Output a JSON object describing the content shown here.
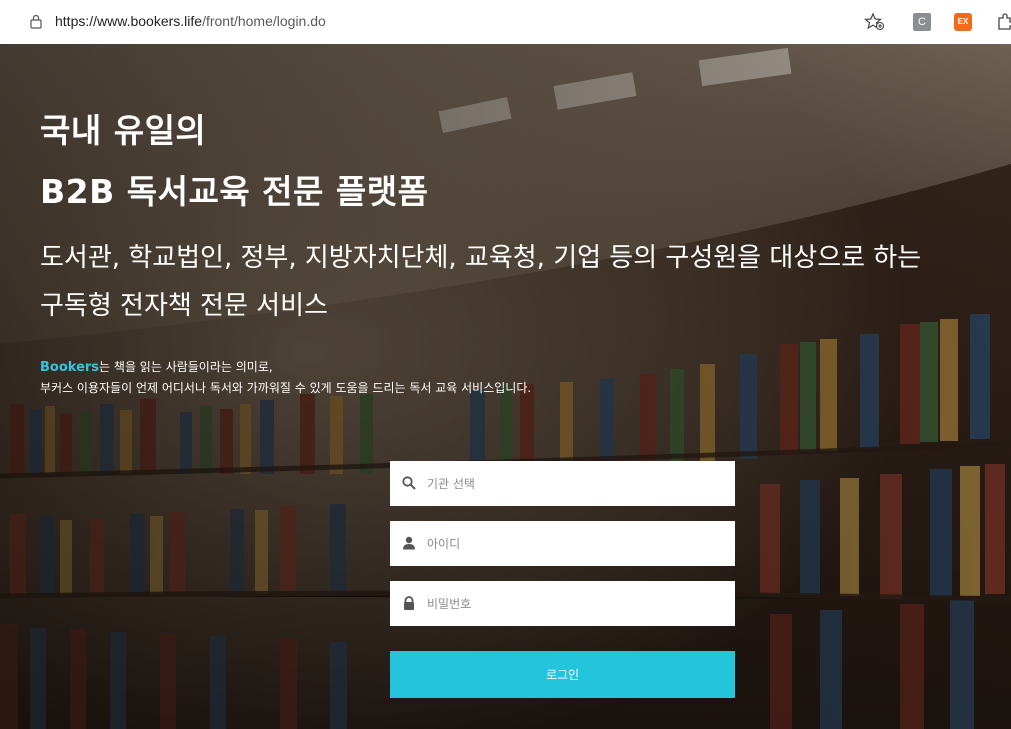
{
  "browser": {
    "url_prefix": "https://www.bookers.life",
    "url_path": "/front/home/login.do",
    "extension_c": "C",
    "extension_ex": "EX"
  },
  "hero": {
    "title_line1": "국내 유일의",
    "title_line2": "B2B 독서교육 전문 플랫폼",
    "subtitle_line1": "도서관, 학교법인, 정부, 지방자치단체, 교육청, 기업 등의 구성원을 대상으로 하는",
    "subtitle_line2": "구독형 전자책 전문 서비스",
    "brand": "Bookers",
    "desc_line1_rest": "는 책을 읽는 사람들이라는 의미로,",
    "desc_line2": "부커스 이용자들이 언제 어디서나 독서와 가까워질 수 있게 도움을 드리는 독서 교육 서비스입니다."
  },
  "login": {
    "institution_placeholder": "기관 선택",
    "id_placeholder": "아이디",
    "password_placeholder": "비밀번호",
    "login_label": "로그인"
  },
  "colors": {
    "accent": "#23c4dc",
    "brand_text": "#33c6de"
  }
}
